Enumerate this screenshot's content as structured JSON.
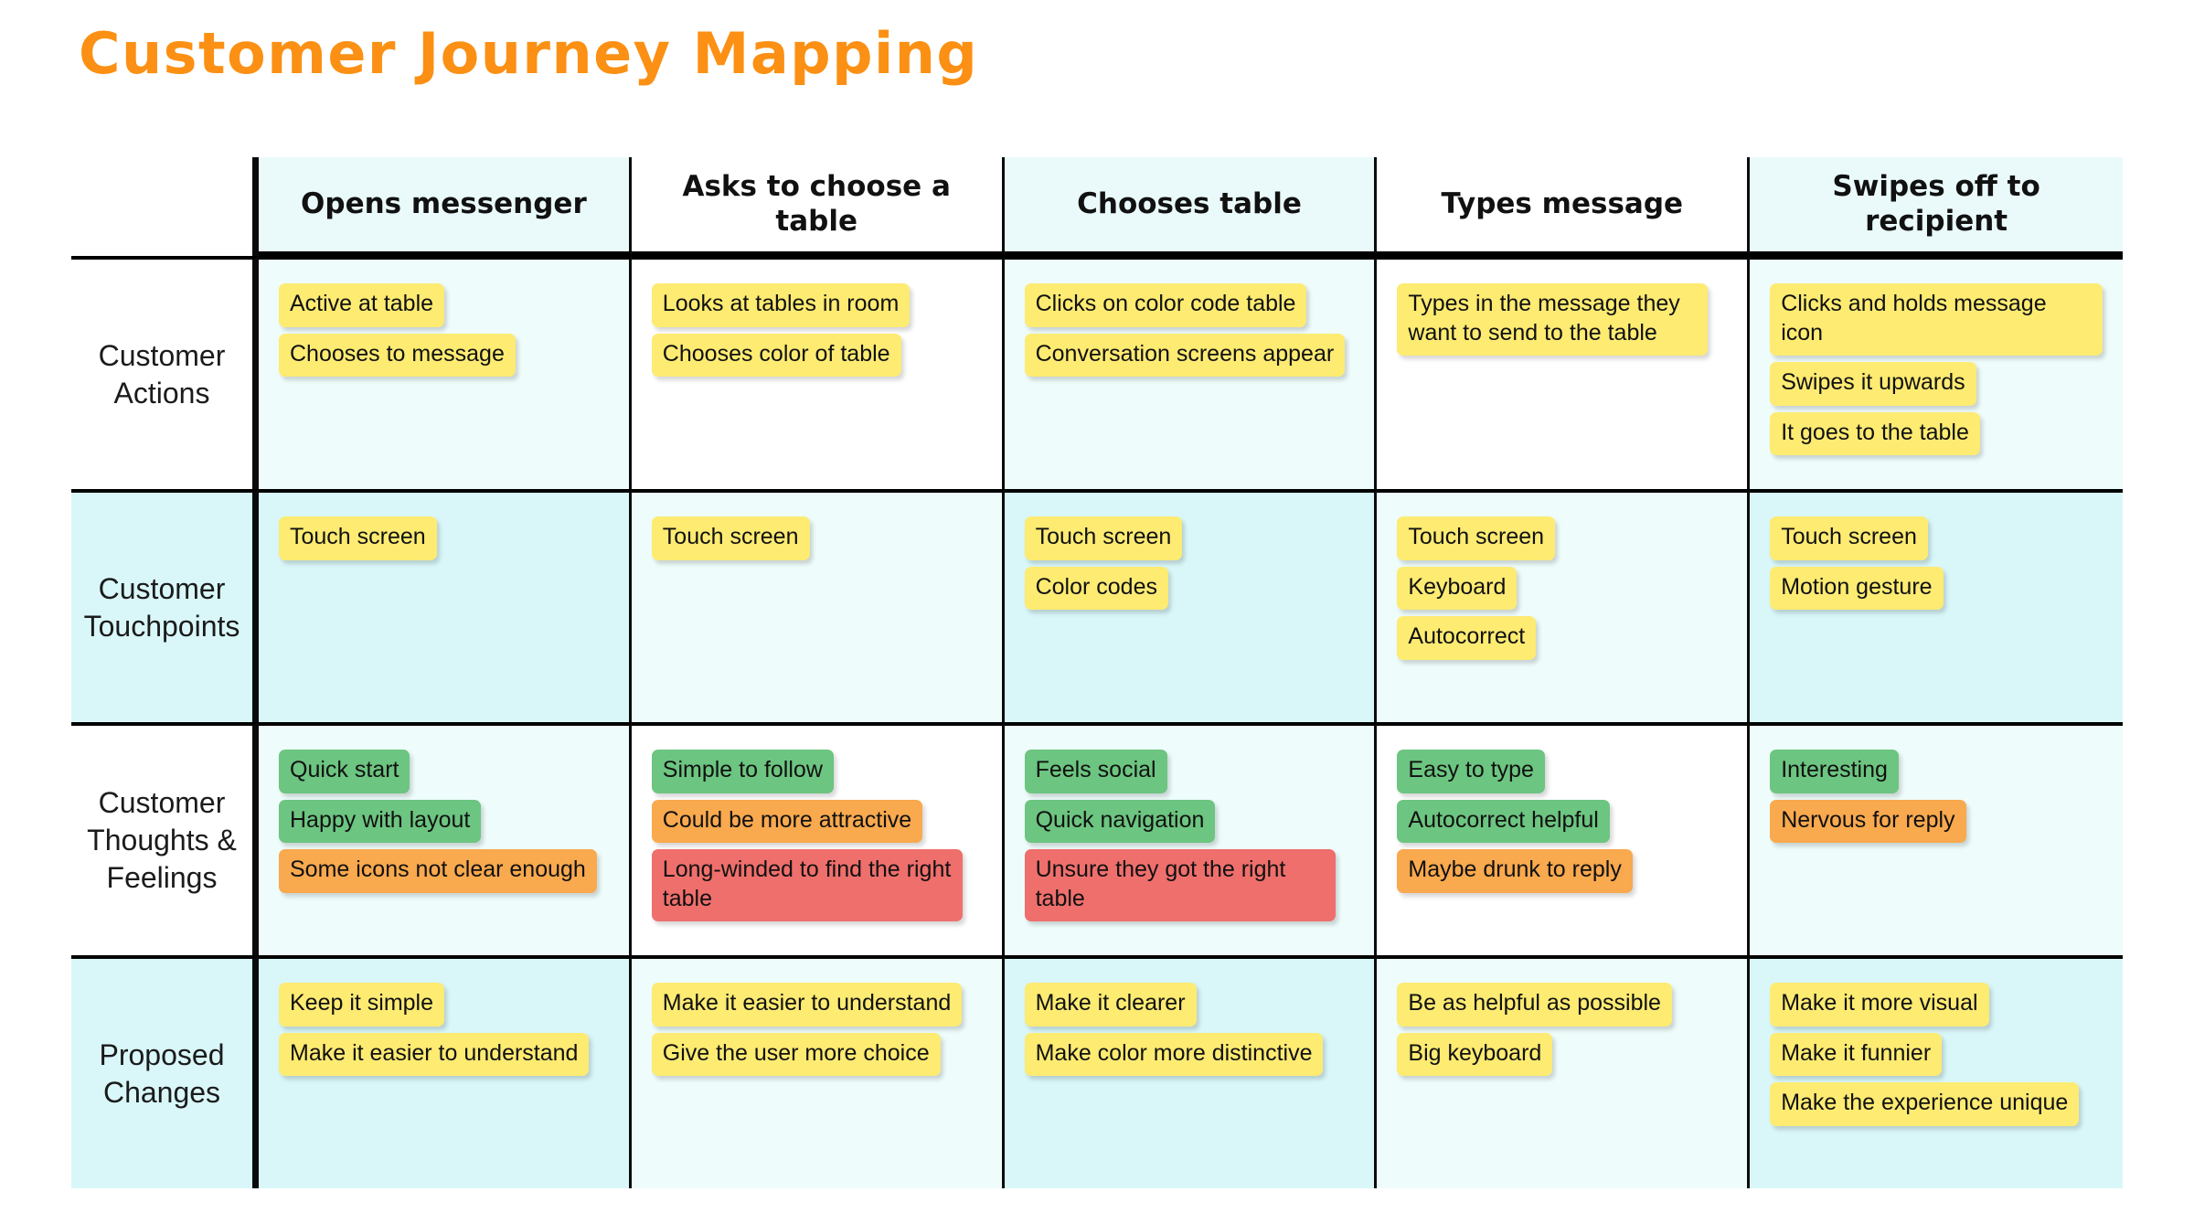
{
  "title": "Customer Journey Mapping",
  "accent_color": "#fb9014",
  "chip_colors": {
    "yellow": "#fdeb72",
    "green": "#6cc580",
    "orange": "#f9a94e",
    "red": "#ef6f6c"
  },
  "row_tints": {
    "pale_cyan": "#eefcfb",
    "cyan": "#d9f7f9",
    "white": "#ffffff"
  },
  "columns": [
    {
      "label": "Opens messenger"
    },
    {
      "label": "Asks to choose a table"
    },
    {
      "label": "Chooses table"
    },
    {
      "label": "Types message"
    },
    {
      "label": "Swipes off to recipient"
    }
  ],
  "rows": [
    {
      "label": "Customer Actions",
      "cells": [
        {
          "chips": [
            {
              "text": "Active at table",
              "color": "yellow"
            },
            {
              "text": "Chooses to message",
              "color": "yellow"
            }
          ]
        },
        {
          "chips": [
            {
              "text": "Looks at tables in room",
              "color": "yellow"
            },
            {
              "text": "Chooses color of table",
              "color": "yellow"
            }
          ]
        },
        {
          "chips": [
            {
              "text": "Clicks on color code table",
              "color": "yellow"
            },
            {
              "text": "Conversation screens appear",
              "color": "yellow"
            }
          ]
        },
        {
          "chips": [
            {
              "text": "Types in the message they want to send to the table",
              "color": "yellow"
            }
          ]
        },
        {
          "chips": [
            {
              "text": "Clicks and holds message icon",
              "color": "yellow"
            },
            {
              "text": "Swipes it upwards",
              "color": "yellow"
            },
            {
              "text": "It goes to the table",
              "color": "yellow"
            }
          ]
        }
      ]
    },
    {
      "label": "Customer Touchpoints",
      "cells": [
        {
          "chips": [
            {
              "text": "Touch screen",
              "color": "yellow"
            }
          ]
        },
        {
          "chips": [
            {
              "text": "Touch screen",
              "color": "yellow"
            }
          ]
        },
        {
          "chips": [
            {
              "text": "Touch screen",
              "color": "yellow"
            },
            {
              "text": "Color codes",
              "color": "yellow"
            }
          ]
        },
        {
          "chips": [
            {
              "text": "Touch screen",
              "color": "yellow"
            },
            {
              "text": "Keyboard",
              "color": "yellow"
            },
            {
              "text": "Autocorrect",
              "color": "yellow"
            }
          ]
        },
        {
          "chips": [
            {
              "text": "Touch screen",
              "color": "yellow"
            },
            {
              "text": "Motion gesture",
              "color": "yellow"
            }
          ]
        }
      ]
    },
    {
      "label": "Customer Thoughts & Feelings",
      "cells": [
        {
          "chips": [
            {
              "text": "Quick start",
              "color": "green"
            },
            {
              "text": "Happy with layout",
              "color": "green"
            },
            {
              "text": "Some icons not clear enough",
              "color": "orange"
            }
          ]
        },
        {
          "chips": [
            {
              "text": "Simple to follow",
              "color": "green"
            },
            {
              "text": "Could be more attractive",
              "color": "orange"
            },
            {
              "text": "Long-winded to find the right table",
              "color": "red"
            }
          ]
        },
        {
          "chips": [
            {
              "text": "Feels social",
              "color": "green"
            },
            {
              "text": "Quick navigation",
              "color": "green"
            },
            {
              "text": "Unsure they got the right table",
              "color": "red"
            }
          ]
        },
        {
          "chips": [
            {
              "text": "Easy to type",
              "color": "green"
            },
            {
              "text": "Autocorrect helpful",
              "color": "green"
            },
            {
              "text": "Maybe drunk to reply",
              "color": "orange"
            }
          ]
        },
        {
          "chips": [
            {
              "text": "Interesting",
              "color": "green"
            },
            {
              "text": "Nervous for reply",
              "color": "orange"
            }
          ]
        }
      ]
    },
    {
      "label": "Proposed Changes",
      "cells": [
        {
          "chips": [
            {
              "text": "Keep it simple",
              "color": "yellow"
            },
            {
              "text": "Make it easier to understand",
              "color": "yellow"
            }
          ]
        },
        {
          "chips": [
            {
              "text": "Make it easier to understand",
              "color": "yellow"
            },
            {
              "text": "Give the user more choice",
              "color": "yellow"
            }
          ]
        },
        {
          "chips": [
            {
              "text": "Make it clearer",
              "color": "yellow"
            },
            {
              "text": "Make color more distinctive",
              "color": "yellow"
            }
          ]
        },
        {
          "chips": [
            {
              "text": "Be as helpful as possible",
              "color": "yellow"
            },
            {
              "text": "Big keyboard",
              "color": "yellow"
            }
          ]
        },
        {
          "chips": [
            {
              "text": "Make it more visual",
              "color": "yellow"
            },
            {
              "text": "Make it funnier",
              "color": "yellow"
            },
            {
              "text": "Make the experience unique",
              "color": "yellow"
            }
          ]
        }
      ]
    }
  ]
}
